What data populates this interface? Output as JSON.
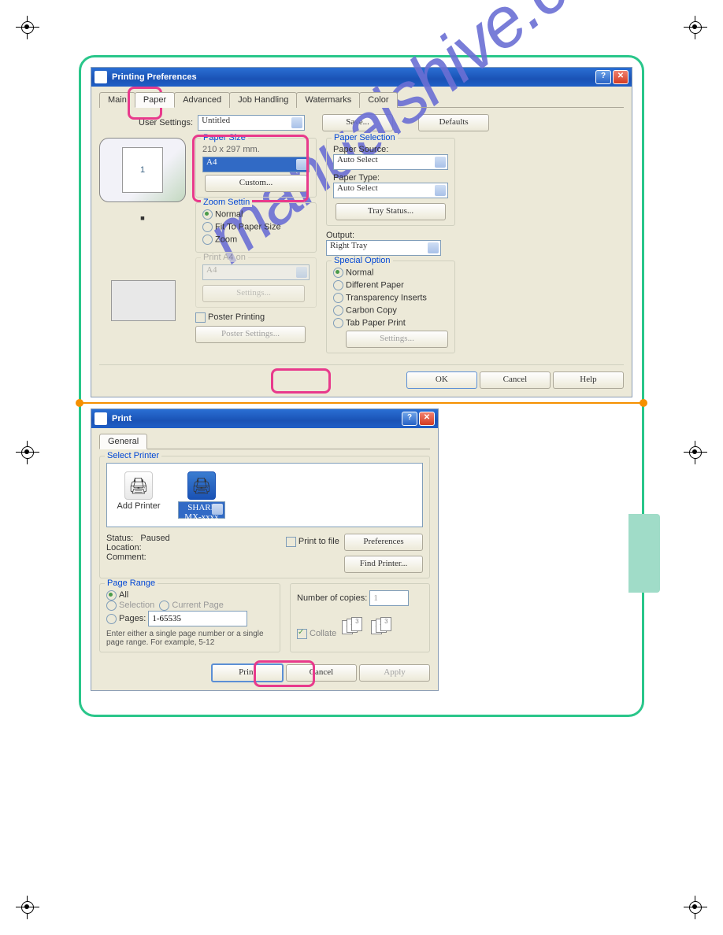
{
  "watermark": "manualshive.com",
  "dialog1": {
    "title": "Printing Preferences",
    "tabs": [
      "Main",
      "Paper",
      "Advanced",
      "Job Handling",
      "Watermarks",
      "Color"
    ],
    "active_tab": "Paper",
    "user_settings_label": "User Settings:",
    "user_settings_value": "Untitled",
    "save_btn": "Save...",
    "defaults_btn": "Defaults",
    "preview_num": "1",
    "paper_size": {
      "legend": "Paper Size",
      "dims": "210 x 297 mm.",
      "value": "A4",
      "custom_btn": "Custom..."
    },
    "zoom": {
      "legend": "Zoom Settin",
      "normal": "Normal",
      "fit": "Fit To Paper Size",
      "zoom": "Zoom"
    },
    "print_on": {
      "legend": "Print A4 on",
      "value": "A4",
      "settings_btn": "Settings..."
    },
    "poster_chk": "Poster Printing",
    "poster_btn": "Poster Settings...",
    "paper_selection": {
      "legend": "Paper Selection",
      "source_label": "Paper Source:",
      "source_value": "Auto Select",
      "type_label": "Paper Type:",
      "type_value": "Auto Select",
      "tray_btn": "Tray Status..."
    },
    "output_label": "Output:",
    "output_value": "Right Tray",
    "special": {
      "legend": "Special Option",
      "normal": "Normal",
      "different": "Different Paper",
      "transparency": "Transparency Inserts",
      "carbon": "Carbon Copy",
      "tabpaper": "Tab Paper Print",
      "settings_btn": "Settings..."
    },
    "ok_btn": "OK",
    "cancel_btn": "Cancel",
    "help_btn": "Help"
  },
  "dialog2": {
    "title": "Print",
    "tab": "General",
    "select_printer_legend": "Select Printer",
    "add_printer": "Add Printer",
    "printer_name": "SHARP\nMX-xxxx",
    "status_label": "Status:",
    "status_value": "Paused",
    "location_label": "Location:",
    "comment_label": "Comment:",
    "print_to_file": "Print to file",
    "preferences_btn": "Preferences",
    "find_printer_btn": "Find Printer...",
    "page_range": {
      "legend": "Page Range",
      "all": "All",
      "selection": "Selection",
      "current": "Current Page",
      "pages": "Pages:",
      "pages_value": "1-65535",
      "hint": "Enter either a single page number or a single page range.  For example, 5-12"
    },
    "copies_label": "Number of copies:",
    "copies_value": "1",
    "collate_label": "Collate",
    "print_btn": "Print",
    "cancel_btn": "Cancel",
    "apply_btn": "Apply"
  }
}
